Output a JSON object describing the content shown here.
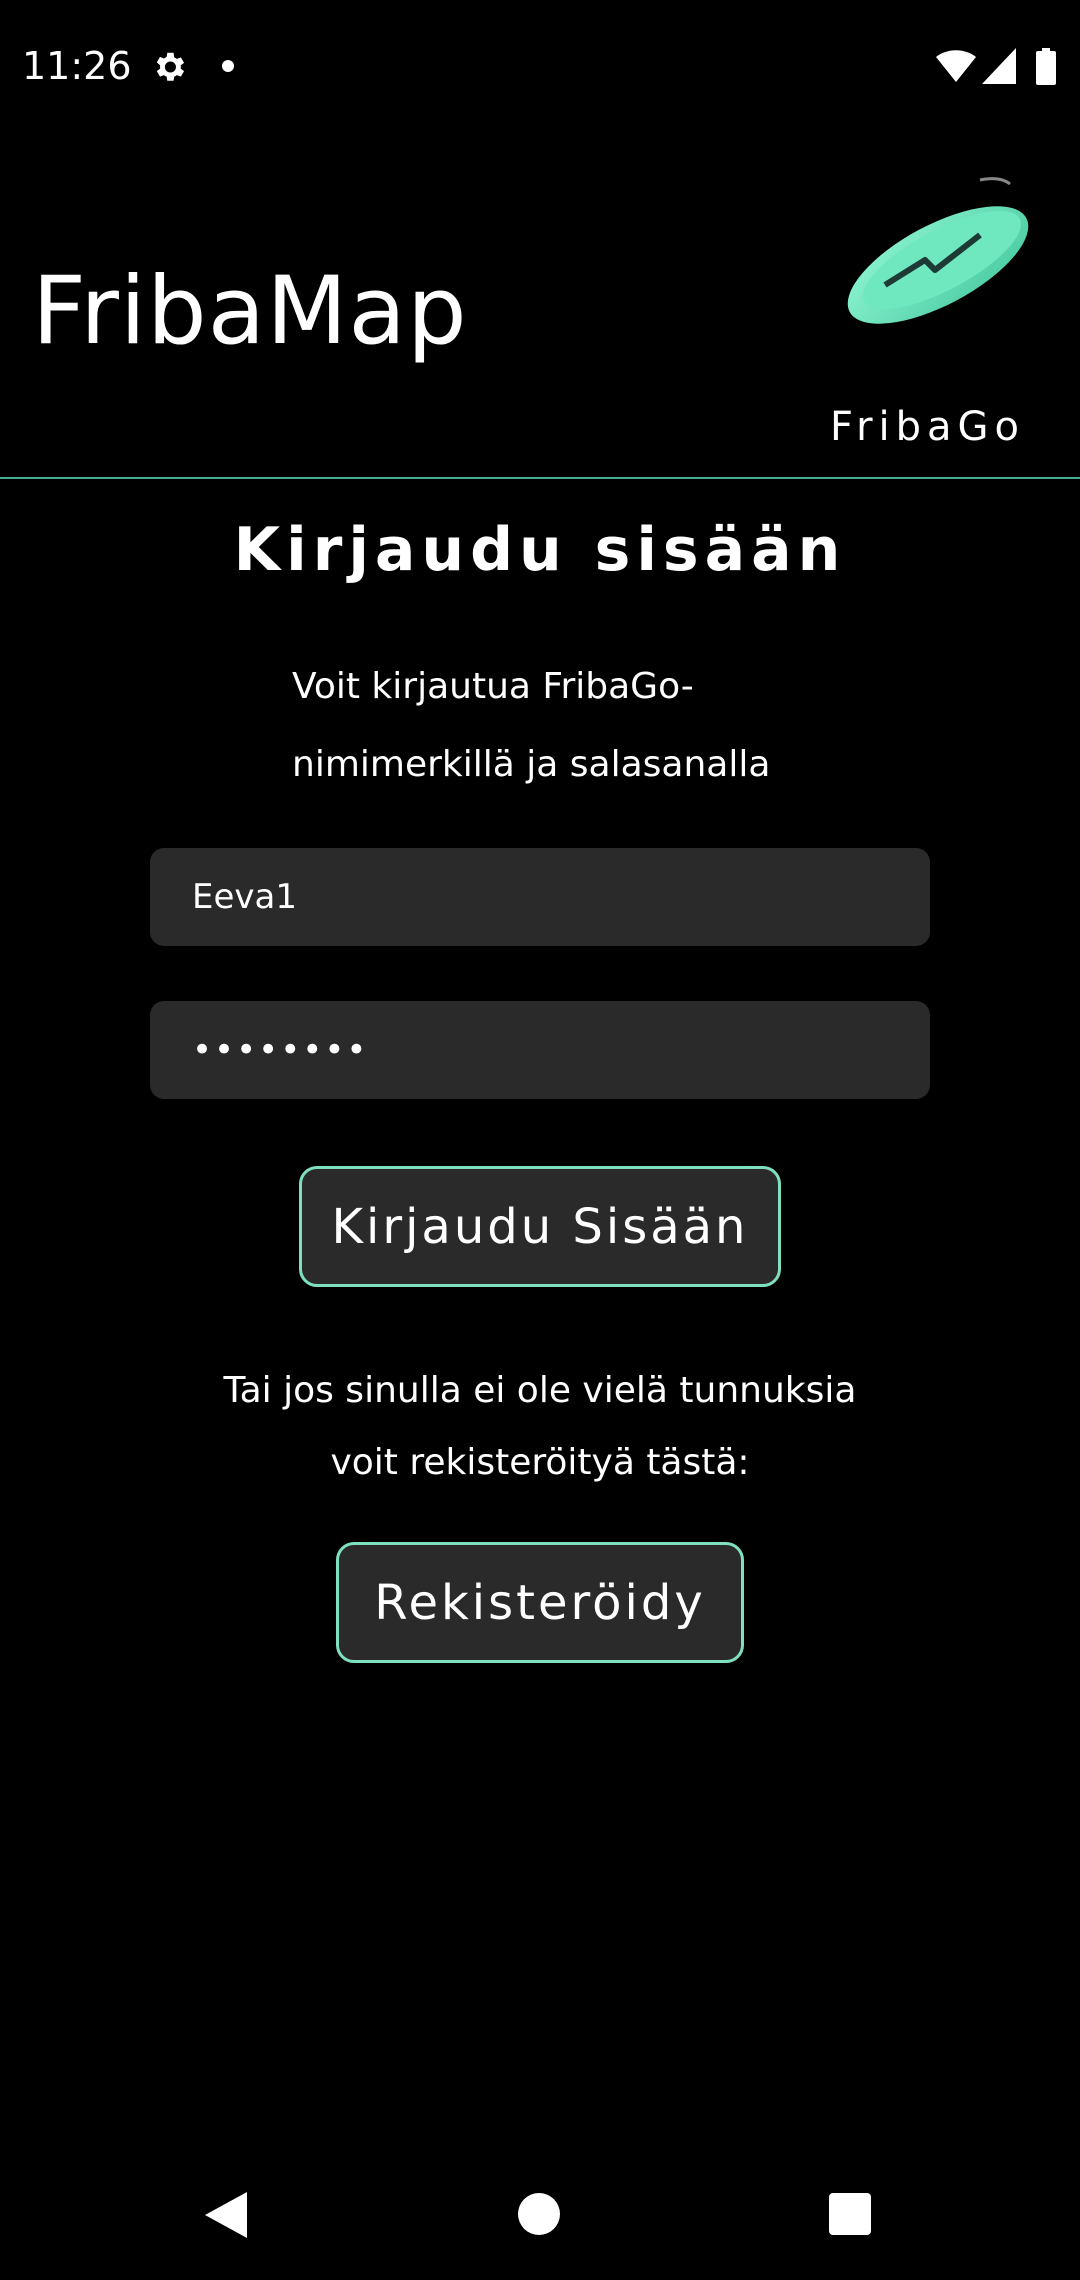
{
  "status_bar": {
    "time": "11:26",
    "icons": [
      "gear-icon",
      "notification-dot-icon",
      "wifi-icon",
      "signal-icon",
      "battery-icon"
    ]
  },
  "header": {
    "title": "FribaMap",
    "logo_text": "FribaGo",
    "accent_color": "#7fe0c0"
  },
  "login": {
    "heading": "Kirjaudu sisään",
    "instruction_line1": "Voit kirjautua FribaGo-",
    "instruction_line2": "nimimerkillä ja salasanalla",
    "username_value": "Eeva1",
    "password_value": "••••••••",
    "submit_label": "Kirjaudu Sisään"
  },
  "register": {
    "prompt_line1": "Tai jos sinulla ei ole vielä tunnuksia",
    "prompt_line2": "voit rekisteröityä tästä:",
    "button_label": "Rekisteröidy"
  },
  "nav_bar": {
    "icons": [
      "back-icon",
      "home-icon",
      "recents-icon"
    ]
  }
}
